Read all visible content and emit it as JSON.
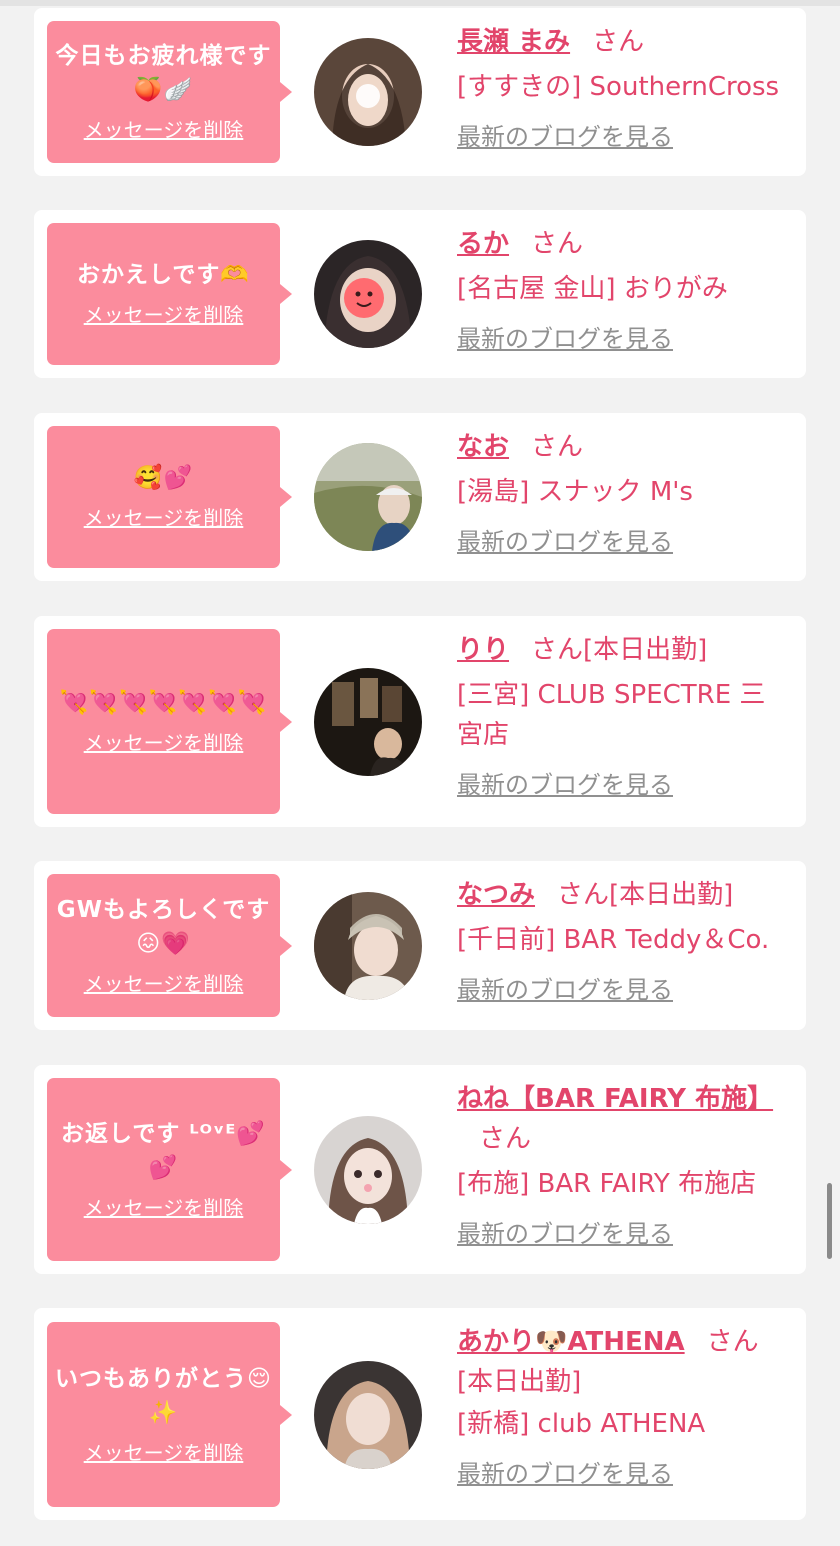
{
  "colors": {
    "accent": "#e2456b",
    "bubble": "#fb8c9d",
    "link_gray": "#909090"
  },
  "cards": [
    {
      "message": "今日もお疲れ様です🍑🪽",
      "delete_label": "メッセージを削除",
      "name": "長瀬 まみ",
      "honorific": "さん",
      "extra": "",
      "shop": "[すすきの] SouthernCross",
      "blog_label": "最新のブログを見る",
      "avatar_icon": "profile-photo"
    },
    {
      "message": "おかえしです🫶",
      "delete_label": "メッセージを削除",
      "name": "るか",
      "honorific": "さん",
      "extra": "",
      "shop": "[名古屋 金山] おりがみ",
      "blog_label": "最新のブログを見る",
      "avatar_icon": "profile-photo"
    },
    {
      "message": "🥰💕",
      "delete_label": "メッセージを削除",
      "name": "なお",
      "honorific": "さん",
      "extra": "",
      "shop": "[湯島] スナック M's",
      "blog_label": "最新のブログを見る",
      "avatar_icon": "profile-photo"
    },
    {
      "message": "💘💘💘💘💘💘💘",
      "delete_label": "メッセージを削除",
      "name": "りり",
      "honorific": "さん",
      "extra": "[本日出勤]",
      "shop": "[三宮] CLUB SPECTRE 三宮店",
      "blog_label": "最新のブログを見る",
      "avatar_icon": "profile-photo"
    },
    {
      "message": "GWもよろしくです😖💗",
      "delete_label": "メッセージを削除",
      "name": "なつみ",
      "honorific": "さん",
      "extra": "[本日出勤]",
      "shop": "[千日前] BAR Teddy＆Co.",
      "blog_label": "最新のブログを見る",
      "avatar_icon": "profile-photo"
    },
    {
      "message": "お返しです ᴸᴼᵛᴱ💕💕",
      "delete_label": "メッセージを削除",
      "name": "ねね【BAR FAIRY 布施】",
      "honorific": "さん",
      "extra": "",
      "shop": "[布施] BAR FAIRY 布施店",
      "blog_label": "最新のブログを見る",
      "avatar_icon": "profile-photo"
    },
    {
      "message": "いつもありがとう😌✨",
      "delete_label": "メッセージを削除",
      "name": "あかり🐶ATHENA",
      "honorific": "さん",
      "extra": "",
      "status": "[本日出勤]",
      "shop": "[新橋] club ATHENA",
      "blog_label": "最新のブログを見る",
      "avatar_icon": "profile-photo"
    }
  ]
}
